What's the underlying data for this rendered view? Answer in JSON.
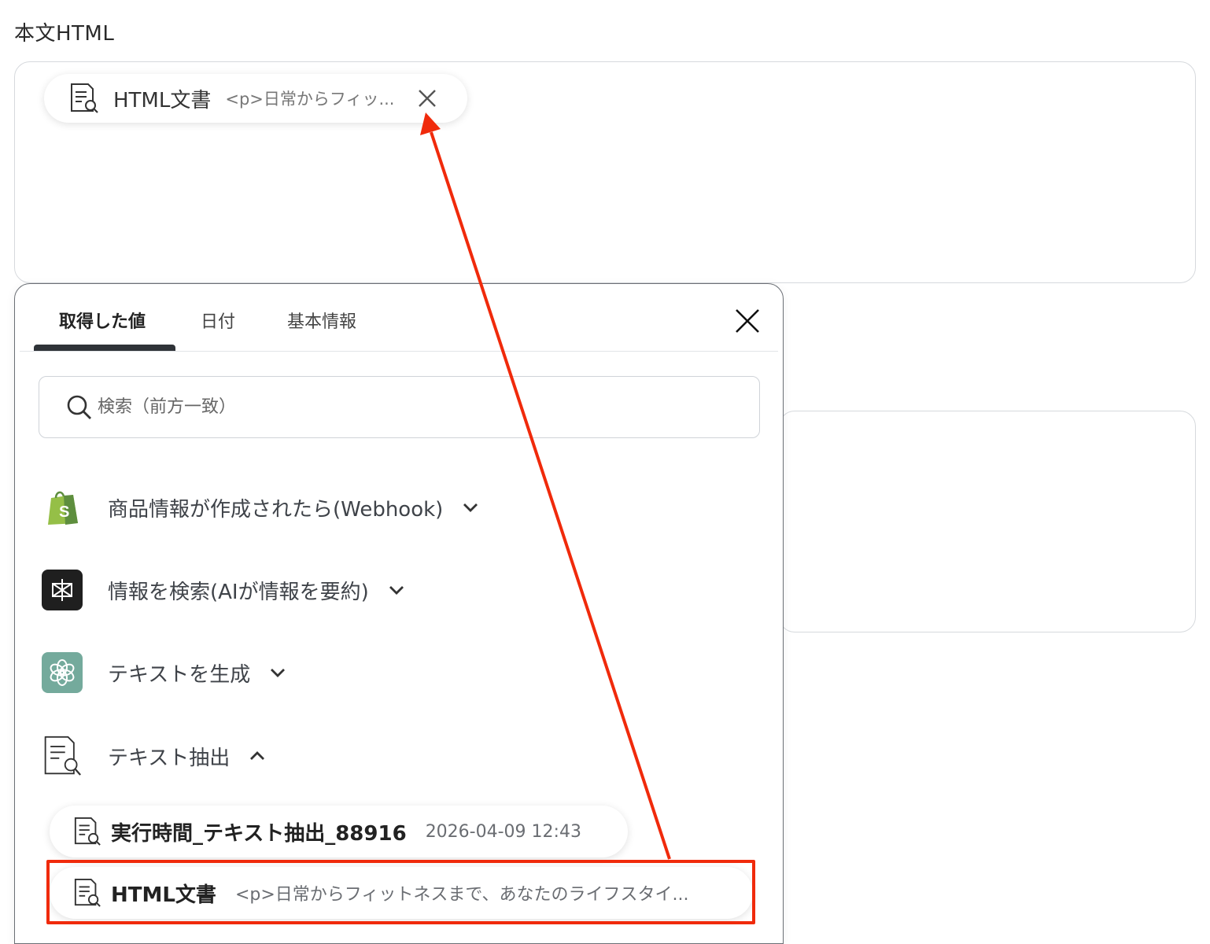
{
  "field": {
    "label": "本文HTML",
    "chip": {
      "title": "HTML文書",
      "value": "<p>日常からフィッ..."
    }
  },
  "panel": {
    "tabs": [
      {
        "label": "取得した値",
        "active": true
      },
      {
        "label": "日付",
        "active": false
      },
      {
        "label": "基本情報",
        "active": false
      }
    ],
    "search": {
      "placeholder": "検索（前方一致）",
      "value": ""
    },
    "groups": [
      {
        "label": "商品情報が作成されたら(Webhook)",
        "app": "shopify-icon",
        "expanded": false
      },
      {
        "label": "情報を検索(AIが情報を要約)",
        "app": "perplexity-icon",
        "expanded": false
      },
      {
        "label": "テキストを生成",
        "app": "openai-icon",
        "expanded": false
      },
      {
        "label": "テキスト抽出",
        "app": "text-extract-icon",
        "expanded": true
      }
    ],
    "items": [
      {
        "title": "実行時間_テキスト抽出_88916",
        "value": "2026-04-09 12:43"
      },
      {
        "title": "HTML文書",
        "value": "<p>日常からフィットネスまで、あなたのライフスタイ..."
      }
    ]
  },
  "colors": {
    "accent_red": "#f02a0b",
    "shopify_green": "#95bf47",
    "openai_green": "#74aa9c",
    "tab_indicator": "#2f3338"
  }
}
